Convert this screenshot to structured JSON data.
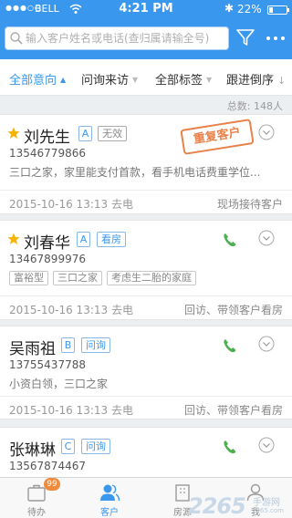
{
  "status_bar": {
    "signal": "●●●○○",
    "carrier": "BELL",
    "time": "4:21 PM",
    "bluetooth": "✱",
    "battery_text": "22%",
    "battery_level": 0.22
  },
  "search": {
    "placeholder": "输入客户姓名或电话(查归属请输全号)"
  },
  "filters": [
    {
      "label": "全部意向",
      "active": true
    },
    {
      "label": "问询来访",
      "active": false
    },
    {
      "label": "全部标签",
      "active": false
    },
    {
      "label": "跟进倒序",
      "active": false
    }
  ],
  "total": "总数: 148人",
  "customers": [
    {
      "name": "刘先生",
      "starred": true,
      "level": "A",
      "status": "无效",
      "phone": "13546779866",
      "description": "三口之家，家里能支付首款，看手机电话费重学位...",
      "tags": [],
      "stamp": "重复客户",
      "date": "2015-10-16 13:13 去电",
      "action": "现场接待客户",
      "has_call": false
    },
    {
      "name": "刘春华",
      "starred": true,
      "level": "A",
      "status": "看房",
      "phone": "13467899976",
      "description": "",
      "tags": [
        "富裕型",
        "三口之家",
        "考虑生二胎的家庭"
      ],
      "stamp": "",
      "date": "2015-10-16 13:13 去电",
      "action": "回访、带领客户看房",
      "has_call": true
    },
    {
      "name": "吴雨祖",
      "starred": false,
      "level": "B",
      "status": "问询",
      "phone": "13755437788",
      "description": "小资白领，三口之家",
      "tags": [],
      "stamp": "",
      "date": "2015-10-16 13:13 去电",
      "action": "回访、带领客户看房",
      "has_call": true
    },
    {
      "name": "张琳琳",
      "starred": false,
      "level": "C",
      "status": "问询",
      "phone": "13567874467",
      "description": "",
      "tags": [],
      "stamp": "",
      "date": "",
      "action": "",
      "has_call": true
    }
  ],
  "bottom_nav": [
    {
      "label": "待办",
      "badge": "99",
      "active": false
    },
    {
      "label": "客户",
      "badge": "",
      "active": true
    },
    {
      "label": "房源",
      "badge": "",
      "active": false
    },
    {
      "label": "我",
      "badge": "",
      "active": false
    }
  ],
  "watermark": {
    "brand": "2265",
    "sub": "手游网",
    "url": "2265.com"
  },
  "colors": {
    "primary": "#3a97ee",
    "stamp": "#e8824a",
    "call": "#4caf50",
    "star": "#f5b400"
  }
}
